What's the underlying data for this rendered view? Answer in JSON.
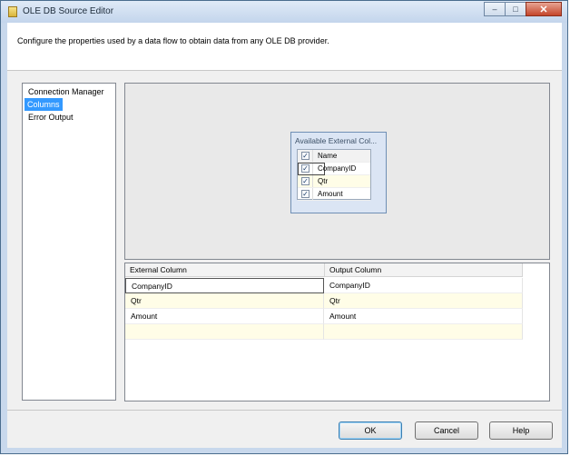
{
  "window": {
    "title": "OLE DB Source Editor",
    "controls": {
      "minimize": "–",
      "maximize": "□",
      "close": "✕"
    }
  },
  "header": {
    "description": "Configure the properties used by a data flow to obtain data from any OLE DB provider."
  },
  "nav": {
    "items": [
      {
        "label": "Connection Manager",
        "selected": false
      },
      {
        "label": "Columns",
        "selected": true
      },
      {
        "label": "Error Output",
        "selected": false
      }
    ]
  },
  "available_columns": {
    "title": "Available External Col...",
    "header": "Name",
    "header_checked": true,
    "columns": [
      {
        "name": "CompanyID",
        "checked": true
      },
      {
        "name": "Qtr",
        "checked": true
      },
      {
        "name": "Amount",
        "checked": true
      }
    ]
  },
  "mapping_grid": {
    "headers": {
      "external": "External Column",
      "output": "Output Column"
    },
    "rows": [
      {
        "external": "CompanyID",
        "output": "CompanyID"
      },
      {
        "external": "Qtr",
        "output": "Qtr"
      },
      {
        "external": "Amount",
        "output": "Amount"
      },
      {
        "external": "",
        "output": ""
      }
    ]
  },
  "buttons": {
    "ok": "OK",
    "cancel": "Cancel",
    "help": "Help"
  },
  "colors": {
    "selection": "#3399ff",
    "alt_row": "#fffde7",
    "canvas": "#e9e9e9",
    "panel": "#dbe5f4",
    "titlebar": "#c3d5ec"
  },
  "icons": {
    "app": "ssis-source-icon",
    "checkbox_checked": "✓"
  }
}
